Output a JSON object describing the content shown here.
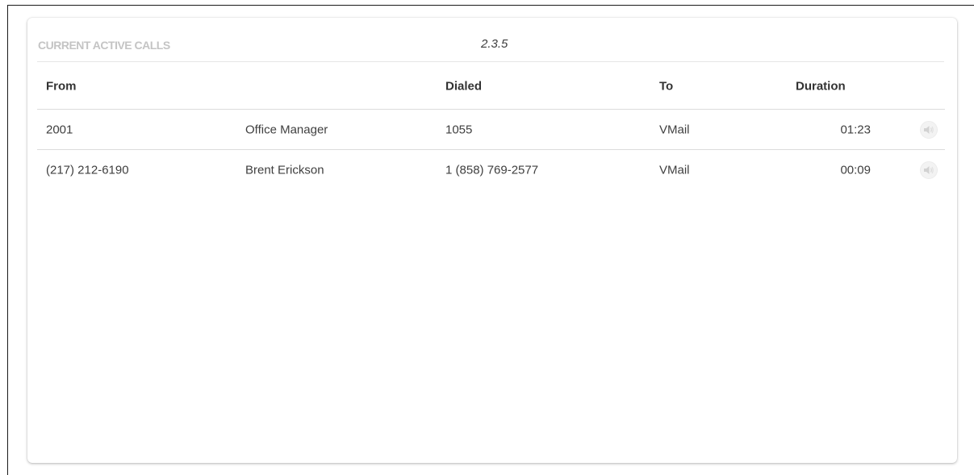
{
  "panel": {
    "title": "CURRENT ACTIVE CALLS",
    "version": "2.3.5"
  },
  "table": {
    "columns": {
      "from": "From",
      "dialed": "Dialed",
      "to": "To",
      "duration": "Duration"
    },
    "rows": [
      {
        "from": "2001",
        "name": "Office Manager",
        "dialed": "1055",
        "to": "VMail",
        "duration": "01:23",
        "action_icon": "speaker-icon"
      },
      {
        "from": "(217) 212-6190",
        "name": "Brent Erickson",
        "dialed": "1 (858) 769-2577",
        "to": "VMail",
        "duration": "00:09",
        "action_icon": "speaker-icon"
      }
    ]
  },
  "colors": {
    "title": "#c4c4c4",
    "text": "#3f3f3f",
    "rule": "#dcdcdc"
  }
}
